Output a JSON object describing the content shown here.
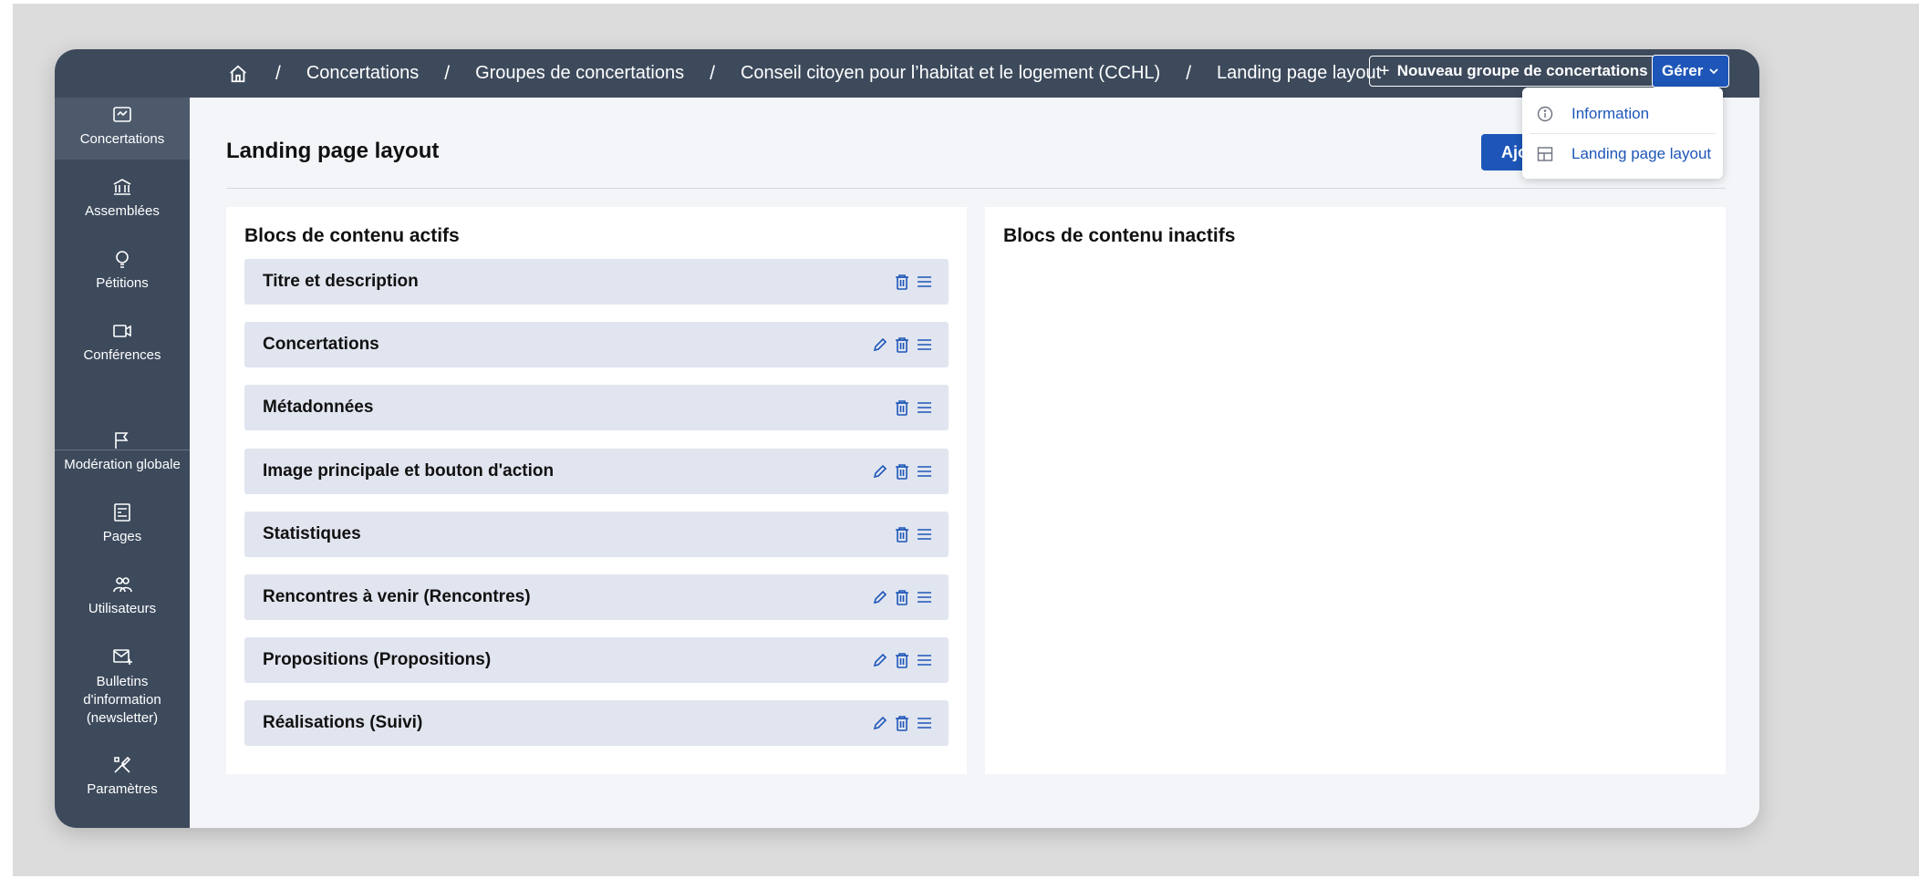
{
  "breadcrumb": {
    "items": [
      "Concertations",
      "Groupes de concertations",
      "Conseil citoyen pour l’habitat et le logement (CCHL)",
      "Landing page layout"
    ],
    "separator": "/"
  },
  "header": {
    "new_group_label": "Nouveau groupe de concertations",
    "manage_label": "Gérer"
  },
  "sidebar": {
    "items": [
      {
        "label": "Concertations",
        "icon": "concertations-icon"
      },
      {
        "label": "Assemblées",
        "icon": "assemblies-icon"
      },
      {
        "label": "Pétitions",
        "icon": "lightbulb-icon"
      },
      {
        "label": "Conférences",
        "icon": "video-icon"
      },
      {
        "label": "Modération globale",
        "icon": "flag-icon"
      },
      {
        "label": "Pages",
        "icon": "pages-icon"
      },
      {
        "label": "Utilisateurs",
        "icon": "users-icon"
      },
      {
        "label": "Bulletins d'information (newsletter)",
        "icon": "mail-icon"
      },
      {
        "label": "Paramètres",
        "icon": "tools-icon"
      }
    ]
  },
  "page": {
    "title": "Landing page layout",
    "add_button_label": "Ajo"
  },
  "active_panel": {
    "title": "Blocs de contenu actifs",
    "blocks": [
      {
        "label": "Titre et description",
        "editable": false
      },
      {
        "label": "Concertations",
        "editable": true
      },
      {
        "label": "Métadonnées",
        "editable": false
      },
      {
        "label": "Image principale et bouton d'action",
        "editable": true
      },
      {
        "label": "Statistiques",
        "editable": false
      },
      {
        "label": "Rencontres à venir (Rencontres)",
        "editable": true
      },
      {
        "label": "Propositions (Propositions)",
        "editable": true
      },
      {
        "label": "Réalisations (Suivi)",
        "editable": true
      }
    ]
  },
  "inactive_panel": {
    "title": "Blocs de contenu inactifs"
  },
  "manage_menu": {
    "items": [
      {
        "label": "Information",
        "icon": "info-icon"
      },
      {
        "label": "Landing page layout",
        "icon": "layout-icon"
      }
    ]
  },
  "colors": {
    "topbar": "#3d4a5c",
    "accent": "#1d56b8",
    "block_bg": "#e1e5ef",
    "page_bg": "#f3f5f8"
  }
}
